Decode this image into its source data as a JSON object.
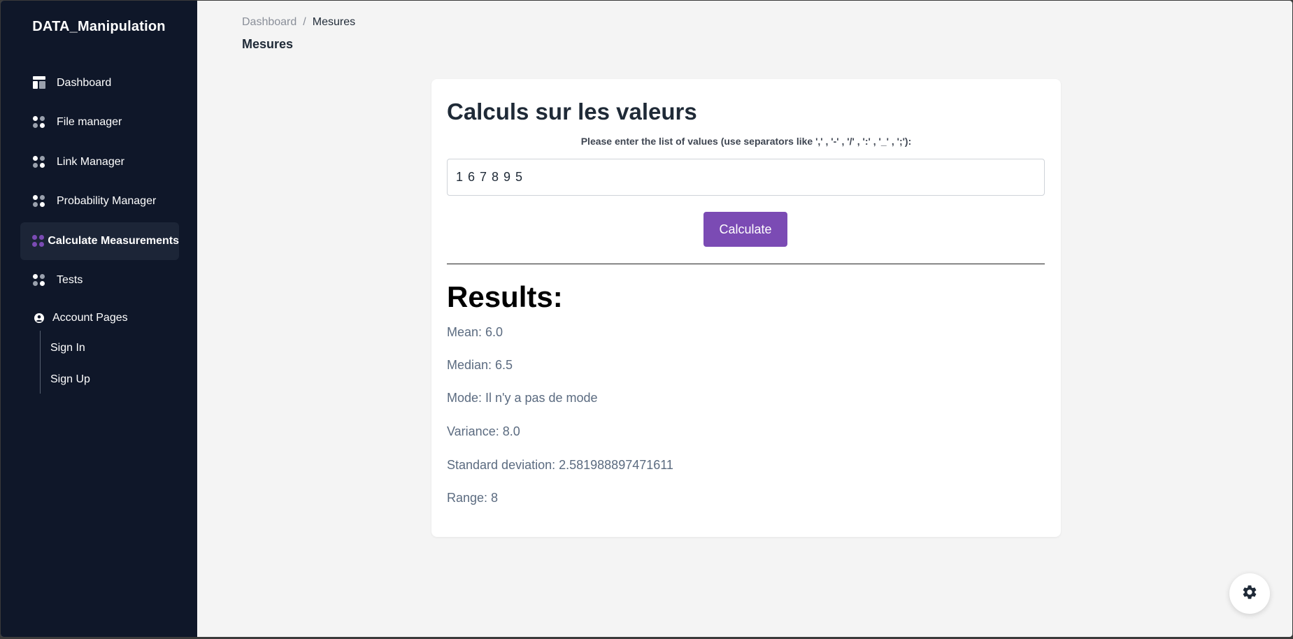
{
  "sidebar": {
    "brand": "DATA_Manipulation",
    "items": [
      {
        "label": "Dashboard",
        "icon": "dashboard-icon"
      },
      {
        "label": "File manager",
        "icon": "grid-icon"
      },
      {
        "label": "Link Manager",
        "icon": "grid-icon"
      },
      {
        "label": "Probability Manager",
        "icon": "grid-icon"
      },
      {
        "label": "Calculate Measurements",
        "icon": "grid-icon",
        "active": true
      },
      {
        "label": "Tests",
        "icon": "grid-icon"
      }
    ],
    "account": {
      "label": "Account Pages",
      "icon": "user-circle-icon",
      "items": [
        {
          "label": "Sign In"
        },
        {
          "label": "Sign Up"
        }
      ]
    }
  },
  "breadcrumb": {
    "parent": "Dashboard",
    "separator": "/",
    "current": "Mesures"
  },
  "page_title": "Mesures",
  "card": {
    "title": "Calculs sur les valeurs",
    "hint": "Please enter the list of values (use separators like ',' , '-' , '/' , ':' , '_' , ';'):",
    "input_value": "1 6 7 8 9 5",
    "button_label": "Calculate",
    "results_title": "Results:",
    "results": [
      "Mean: 6.0",
      "Median: 6.5",
      "Mode: Il n'y a pas de mode",
      "Variance: 8.0",
      "Standard deviation: 2.581988897471611",
      "Range: 8"
    ]
  },
  "colors": {
    "sidebar_bg": "#0f1729",
    "accent": "#7b4bb4",
    "content_bg": "#f4f4f4"
  },
  "fab_icon": "gear-icon"
}
